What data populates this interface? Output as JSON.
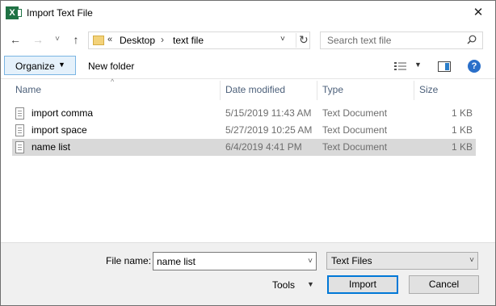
{
  "window": {
    "title": "Import Text File",
    "app_icon_letter": "X",
    "close_glyph": "✕"
  },
  "nav": {
    "back_glyph": "←",
    "forward_glyph": "→",
    "recent_glyph": "˅",
    "up_glyph": "↑",
    "breadcrumb_more": "«",
    "breadcrumb": [
      "Desktop",
      "text file"
    ],
    "breadcrumb_sep": "›",
    "address_drop_glyph": "˅",
    "refresh_glyph": "↻",
    "search_placeholder": "Search text file"
  },
  "toolbar": {
    "organize_label": "Organize",
    "organize_caret": "▼",
    "new_folder_label": "New folder",
    "view_caret": "▼",
    "help_glyph": "?"
  },
  "columns": {
    "name": "Name",
    "date": "Date modified",
    "type": "Type",
    "size": "Size",
    "sort_glyph": "^"
  },
  "files": [
    {
      "name": "import comma",
      "date": "5/15/2019 11:43 AM",
      "type": "Text Document",
      "size": "1 KB",
      "selected": false
    },
    {
      "name": "import space",
      "date": "5/27/2019 10:25 AM",
      "type": "Text Document",
      "size": "1 KB",
      "selected": false
    },
    {
      "name": "name list",
      "date": "6/4/2019 4:41 PM",
      "type": "Text Document",
      "size": "1 KB",
      "selected": true
    }
  ],
  "footer": {
    "file_name_label": "File name:",
    "file_name_value": "name list",
    "file_type_value": "Text Files",
    "dropdown_glyph": "˅",
    "tools_label": "Tools",
    "tools_caret": "▼",
    "import_label": "Import",
    "cancel_label": "Cancel"
  },
  "colors": {
    "accent": "#0078d7",
    "selection": "#d9d9d9",
    "header_text": "#4c607a",
    "excel_green": "#1f7244"
  }
}
